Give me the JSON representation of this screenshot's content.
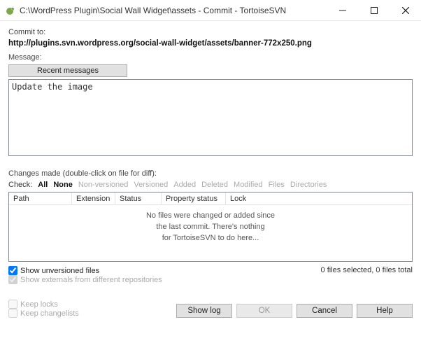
{
  "window": {
    "title": "C:\\WordPress Plugin\\Social Wall Widget\\assets - Commit - TortoiseSVN"
  },
  "commit": {
    "label": "Commit to:",
    "url": "http://plugins.svn.wordpress.org/social-wall-widget/assets/banner-772x250.png"
  },
  "message": {
    "label": "Message:",
    "recent_btn": "Recent messages",
    "value": "Update the image"
  },
  "changes": {
    "label": "Changes made (double-click on file for diff):",
    "check_lead": "Check:",
    "links": {
      "all": "All",
      "none": "None",
      "nonversioned": "Non-versioned",
      "versioned": "Versioned",
      "added": "Added",
      "deleted": "Deleted",
      "modified": "Modified",
      "files": "Files",
      "directories": "Directories"
    },
    "columns": {
      "path": "Path",
      "extension": "Extension",
      "status": "Status",
      "property": "Property status",
      "lock": "Lock"
    },
    "empty1": "No files were changed or added since",
    "empty2": "the last commit. There's nothing",
    "empty3": "for TortoiseSVN to do here...",
    "show_unversioned": "Show unversioned files",
    "show_externals": "Show externals from different repositories",
    "status": "0 files selected, 0 files total"
  },
  "options": {
    "keep_locks": "Keep locks",
    "keep_changelists": "Keep changelists"
  },
  "buttons": {
    "showlog": "Show log",
    "ok": "OK",
    "cancel": "Cancel",
    "help": "Help"
  }
}
